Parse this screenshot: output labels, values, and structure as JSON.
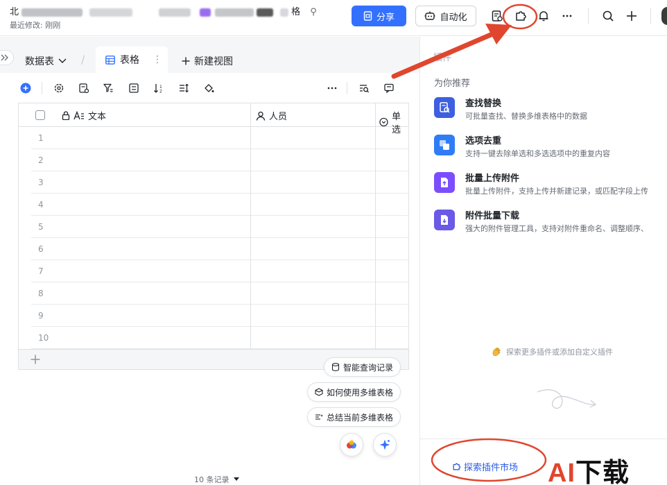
{
  "header": {
    "title_visible_start": "北",
    "title_visible_end": "格",
    "subtitle": "最近修改: 刚刚",
    "share_label": "分享",
    "automation_label": "自动化"
  },
  "tabs": {
    "datatable_label": "数据表",
    "grid_tab_label": "表格",
    "new_view_label": "新建视图"
  },
  "grid": {
    "columns": [
      {
        "label": "文本"
      },
      {
        "label": "人员"
      },
      {
        "label": "单选"
      }
    ],
    "row_numbers": [
      "1",
      "2",
      "3",
      "4",
      "5",
      "6",
      "7",
      "8",
      "9",
      "10"
    ],
    "record_count": "10 条记录"
  },
  "assist": {
    "smart_query": "智能查询记录",
    "how_to_use": "如何使用多维表格",
    "summarize": "总结当前多维表格"
  },
  "panel": {
    "title": "插件",
    "recommend_label": "为你推荐",
    "plugins": [
      {
        "name": "查找替换",
        "desc": "可批量查找、替换多维表格中的数据",
        "color": "#3d5fe0"
      },
      {
        "name": "选项去重",
        "desc": "支持一键去除单选和多选选项中的重复内容",
        "color": "#2f7cf6"
      },
      {
        "name": "批量上传附件",
        "desc": "批量上传附件，支持上传并新建记录，或匹配字段上传",
        "color": "#7c4dff"
      },
      {
        "name": "附件批量下载",
        "desc": "强大的附件管理工具，支持对附件重命名、调整顺序、",
        "color": "#6a5ae6"
      }
    ],
    "explore_more": "探索更多插件或添加自定义插件",
    "market_label": "探索插件市场"
  },
  "watermark": {
    "prefix": "AI",
    "suffix": "下载"
  },
  "colors": {
    "accent": "#3370ff",
    "annotation": "#e0462e"
  }
}
